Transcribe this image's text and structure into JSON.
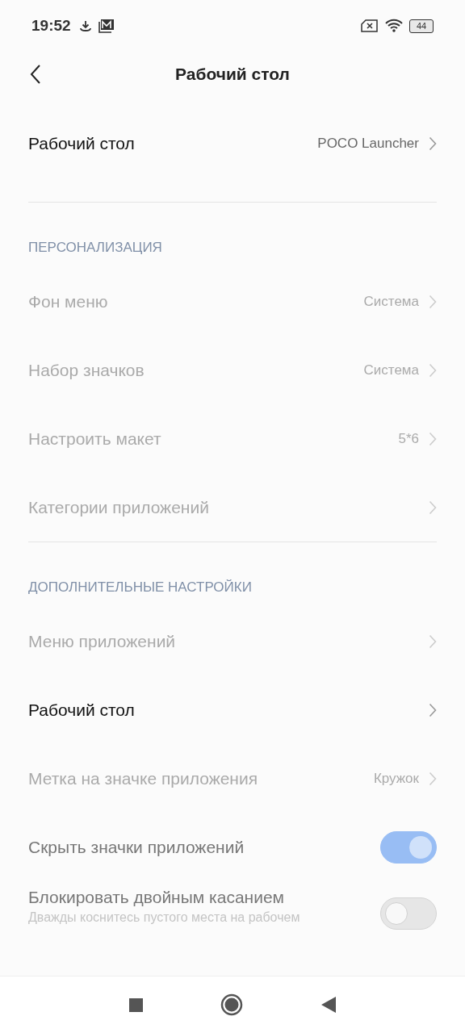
{
  "status_bar": {
    "time": "19:52",
    "battery": "44"
  },
  "header": {
    "title": "Рабочий стол"
  },
  "top_row": {
    "kind": "link",
    "label": "Рабочий стол",
    "value": "POCO Launcher",
    "disabled": false
  },
  "sections": [
    {
      "title": "ПЕРСОНАЛИЗАЦИЯ",
      "rows": [
        {
          "kind": "link",
          "label": "Фон меню",
          "value": "Система",
          "disabled": true
        },
        {
          "kind": "link",
          "label": "Набор значков",
          "value": "Система",
          "disabled": true
        },
        {
          "kind": "link",
          "label": "Настроить макет",
          "value": "5*6",
          "disabled": true
        },
        {
          "kind": "link",
          "label": "Категории приложений",
          "disabled": true
        }
      ]
    },
    {
      "title": "ДОПОЛНИТЕЛЬНЫЕ НАСТРОЙКИ",
      "rows": [
        {
          "kind": "link",
          "label": "Меню приложений",
          "disabled": true
        },
        {
          "kind": "link",
          "label": "Рабочий стол",
          "disabled": false
        },
        {
          "kind": "link",
          "label": "Метка на значке приложения",
          "value": "Кружок",
          "disabled": true
        },
        {
          "kind": "toggle",
          "label": "Скрыть значки приложений",
          "on": true,
          "disabled": true
        },
        {
          "kind": "toggle",
          "label": "Блокировать двойным касанием",
          "description": "Дважды коснитесь пустого места на рабочем",
          "on": false,
          "disabled": true
        }
      ]
    }
  ]
}
